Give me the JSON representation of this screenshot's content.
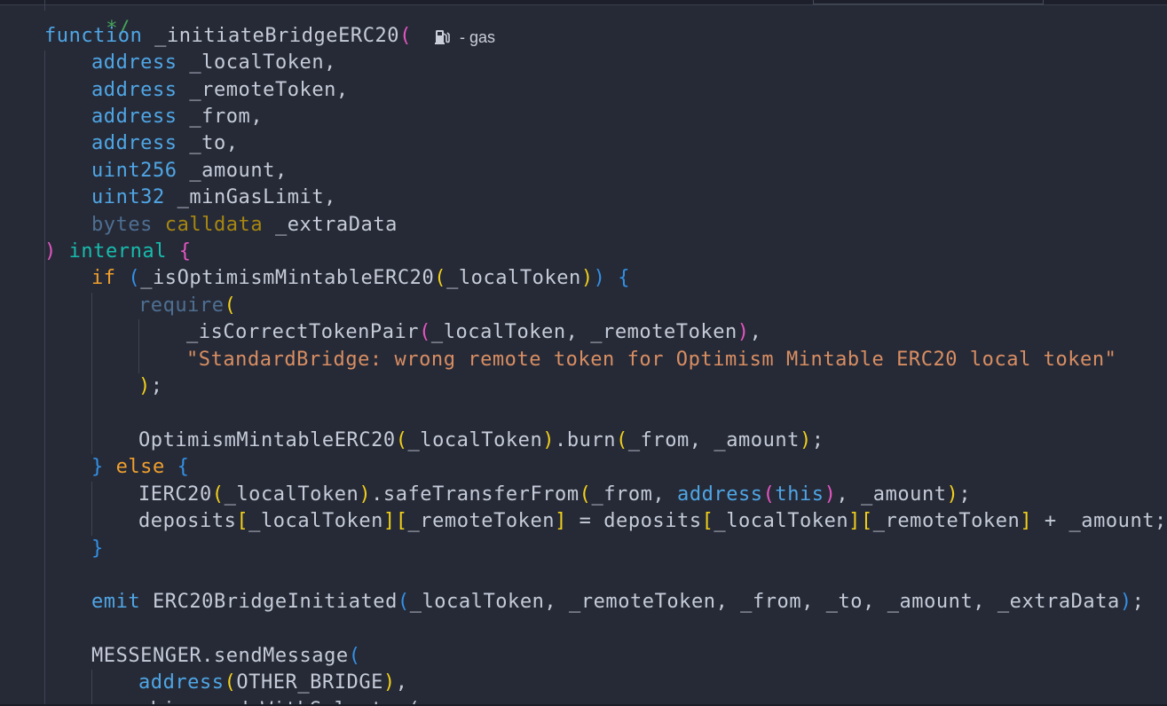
{
  "editor": {
    "comment_tail": "*/",
    "gas_hint": "- gas",
    "gas_icon": "fuel-pump-icon",
    "lines": {
      "l1": {
        "kw": "function",
        "name": "_initiateBridgeERC20"
      },
      "p1": {
        "type": "address",
        "name": "_localToken,"
      },
      "p2": {
        "type": "address",
        "name": "_remoteToken,"
      },
      "p3": {
        "type": "address",
        "name": "_from,"
      },
      "p4": {
        "type": "address",
        "name": "_to,"
      },
      "p5": {
        "type": "uint256",
        "name": "_amount,"
      },
      "p6": {
        "type": "uint32",
        "name": "_minGasLimit,"
      },
      "p7": {
        "type": "bytes",
        "loc": "calldata",
        "name": "_extraData"
      },
      "close": {
        "mod": "internal"
      },
      "if": {
        "kw": "if",
        "call": "_isOptimismMintableERC20",
        "arg": "_localToken"
      },
      "require": {
        "kw": "require"
      },
      "pair": {
        "call": "_isCorrectTokenPair",
        "args": "_localToken, _remoteToken",
        "tail": ","
      },
      "msg": {
        "str": "\"StandardBridge: wrong remote token for Optimism Mintable ERC20 local token\""
      },
      "req_close": {
        "tail": ";"
      },
      "burn": {
        "contract": "OptimismMintableERC20",
        "arg": "_localToken",
        "method": ".burn",
        "args": "_from, _amount",
        "tail": ";"
      },
      "else": {
        "kw": "else"
      },
      "transfer": {
        "contract": "IERC20",
        "arg": "_localToken",
        "method": ".safeTransferFrom",
        "a1": "_from, ",
        "addr": "address",
        "this": "this",
        "a2": ", _amount",
        "tail": ";"
      },
      "deposits": {
        "name": "deposits",
        "k1": "_localToken",
        "k2": "_remoteToken",
        "eq": " = ",
        "plus": " + _amount;"
      },
      "emit": {
        "kw": "emit",
        "event": "ERC20BridgeInitiated",
        "args": "_localToken, _remoteToken, _from, _to, _amount, _extraData",
        "tail": ";"
      },
      "messenger": {
        "obj": "MESSENGER",
        "method": ".sendMessage"
      },
      "address_bridge": {
        "type": "address",
        "arg": "OTHER_BRIDGE",
        "tail": ","
      },
      "partial": {
        "text": "abi.encodeWithSelector("
      }
    }
  }
}
